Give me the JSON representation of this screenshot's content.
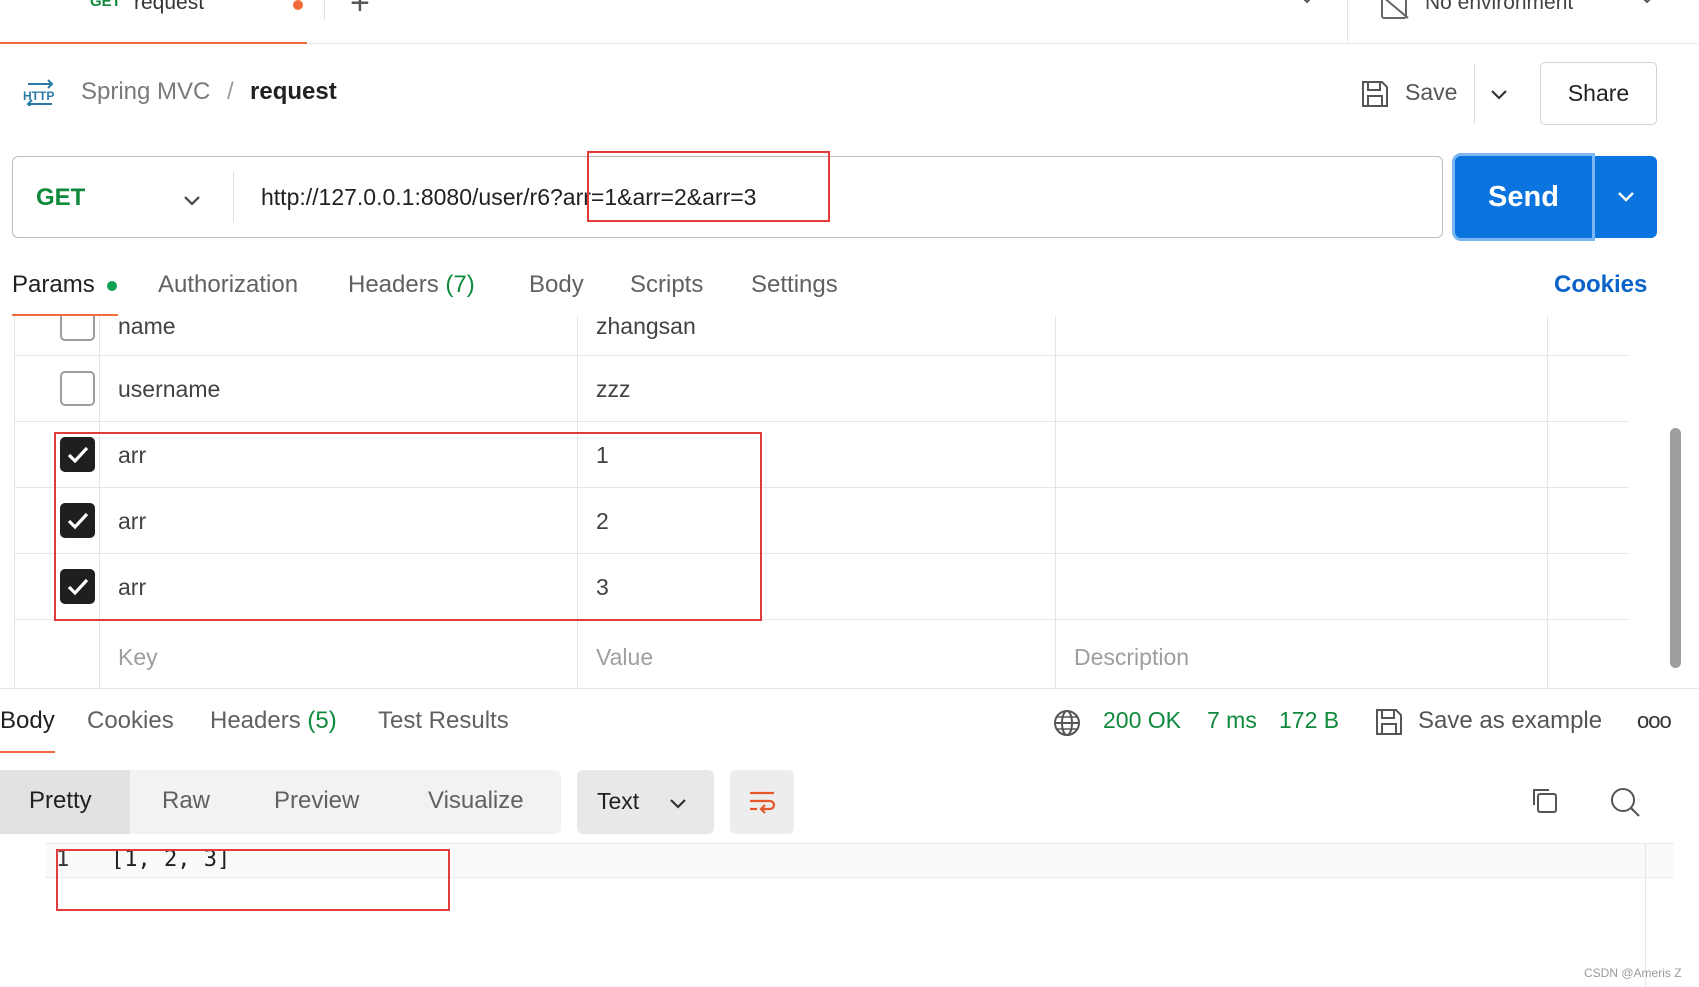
{
  "top_tabs": {
    "active_tab": {
      "method": "GET",
      "name": "request",
      "unsaved": true
    },
    "new_tab_symbol": "+",
    "environment": "No environment"
  },
  "breadcrumb": {
    "protocol_icon": "HTTP",
    "collection": "Spring MVC",
    "separator": "/",
    "request": "request"
  },
  "actions": {
    "save_label": "Save",
    "share_label": "Share"
  },
  "url_bar": {
    "method": "GET",
    "url": "http://127.0.0.1:8080/user/r6?arr=1&arr=2&arr=3",
    "send_label": "Send"
  },
  "request_tabs": {
    "params": "Params",
    "authorization": "Authorization",
    "headers": "Headers",
    "headers_count": "(7)",
    "body": "Body",
    "scripts": "Scripts",
    "settings": "Settings",
    "cookies": "Cookies"
  },
  "params": {
    "rows": [
      {
        "checked": false,
        "key": "name",
        "value": "zhangsan"
      },
      {
        "checked": false,
        "key": "username",
        "value": "zzz"
      },
      {
        "checked": true,
        "key": "arr",
        "value": "1"
      },
      {
        "checked": true,
        "key": "arr",
        "value": "2"
      },
      {
        "checked": true,
        "key": "arr",
        "value": "3"
      }
    ],
    "placeholders": {
      "key": "Key",
      "value": "Value",
      "description": "Description"
    }
  },
  "response": {
    "tabs": {
      "body": "Body",
      "cookies": "Cookies",
      "headers": "Headers",
      "headers_count": "(5)",
      "test_results": "Test Results"
    },
    "status": "200 OK",
    "time": "7 ms",
    "size": "172 B",
    "save_example": "Save as example",
    "more": "ooo"
  },
  "viewer": {
    "modes": [
      "Pretty",
      "Raw",
      "Preview",
      "Visualize"
    ],
    "selected_mode": "Pretty",
    "format": "Text",
    "lines": [
      {
        "number": "1",
        "text": "[1, 2, 3]"
      }
    ]
  },
  "watermark": "CSDN @Ameris Z",
  "colors": {
    "accent_orange": "#f26b3a",
    "send_blue": "#0b74de",
    "method_green": "#0f8a3c",
    "annotation_red": "#e23b3b"
  }
}
